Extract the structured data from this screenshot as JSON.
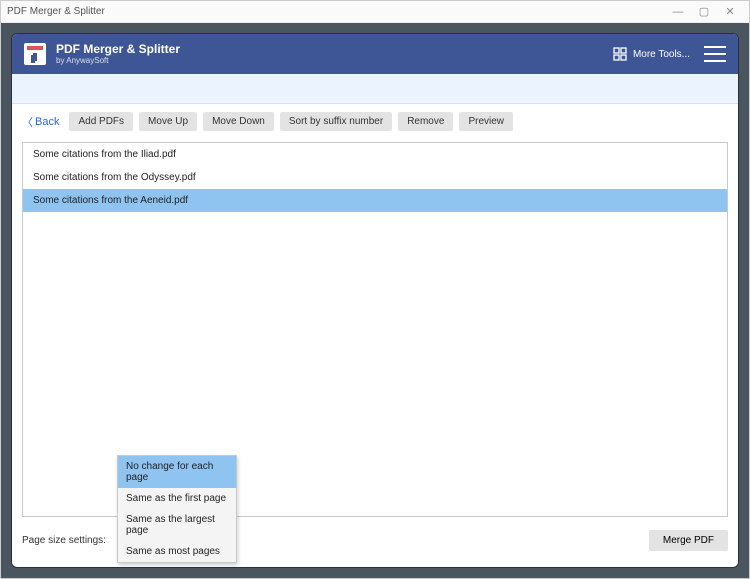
{
  "window": {
    "title": "PDF Merger & Splitter"
  },
  "app": {
    "title": "PDF Merger & Splitter",
    "subtitle": "by AnywaySoft",
    "more_tools_label": "More Tools..."
  },
  "toolbar": {
    "back_label": "Back",
    "add_pdfs": "Add PDFs",
    "move_up": "Move Up",
    "move_down": "Move Down",
    "sort_suffix": "Sort by suffix number",
    "remove": "Remove",
    "preview": "Preview"
  },
  "files": [
    {
      "name": "Some citations from the Iliad.pdf",
      "selected": false
    },
    {
      "name": "Some citations from the Odyssey.pdf",
      "selected": false
    },
    {
      "name": "Some citations from the Aeneid.pdf",
      "selected": true
    }
  ],
  "footer": {
    "page_size_label": "Page size settings:",
    "merge_label": "Merge PDF"
  },
  "page_size_menu": {
    "options": [
      {
        "label": "No change for each page",
        "selected": true
      },
      {
        "label": "Same as the first page",
        "selected": false
      },
      {
        "label": "Same as the largest page",
        "selected": false
      },
      {
        "label": "Same as most pages",
        "selected": false
      }
    ]
  }
}
